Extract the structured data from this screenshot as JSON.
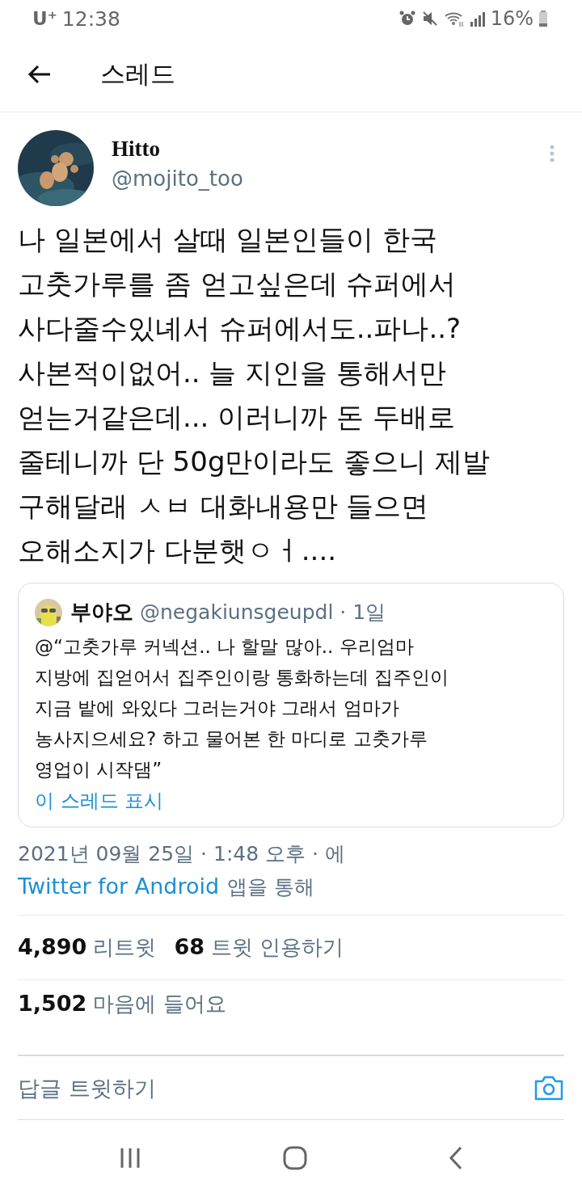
{
  "status_bar": {
    "carrier": "U⁺",
    "time": "12:38",
    "battery": "16%"
  },
  "header": {
    "title": "스레드"
  },
  "tweet": {
    "name": "Hitto",
    "handle": "@mojito_too",
    "text": "나 일본에서 살때 일본인들이 한국\n고춧가루를 좀 얻고싶은데 슈퍼에서\n사다줄수있녜서 슈퍼에서도..파나..?\n사본적이없어.. 늘 지인을 통해서만\n얻는거같은데... 이러니까 돈 두배로\n줄테니까 단 50g만이라도 좋으니 제발\n구해달래 ㅅㅂ 대화내용만 들으면\n오해소지가 다분햇ㅇㅓ....",
    "quote": {
      "name": "부야오",
      "handle": "@negakiunsgeupdl",
      "age": "· 1일",
      "text": "@“고춧가루 커넥션.. 나 할말 많아.. 우리엄마\n지방에 집얻어서 집주인이랑 통화하는데 집주인이\n지금 밭에 와있다 그러는거야 그래서 엄마가\n농사지으세요? 하고 물어본 한 마디로 고춧가루\n영업이 시작댐”",
      "link": "이 스레드 표시"
    },
    "timestamp": "2021년 09월 25일 · 1:48 오후 · 에",
    "source_link": "Twitter for Android",
    "source_suffix": "앱을 통해",
    "stats": [
      {
        "count": "4,890",
        "label": "리트윗"
      },
      {
        "count": "68",
        "label": "트윗 인용하기"
      }
    ],
    "likes": {
      "count": "1,502",
      "label": "마음에 들어요"
    }
  },
  "reply_bar": {
    "placeholder": "답글 트윗하기"
  }
}
